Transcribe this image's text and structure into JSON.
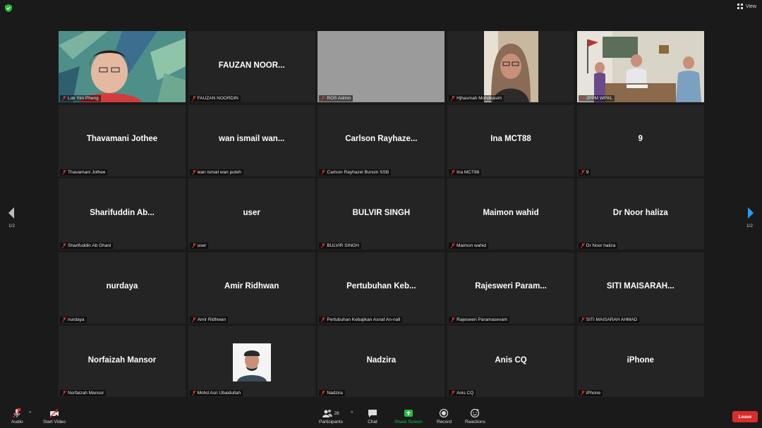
{
  "topbar": {
    "view_label": "View"
  },
  "pagination": {
    "left_page": "1/2",
    "right_page": "1/2"
  },
  "participants": [
    {
      "big": "",
      "label": "Lok Yim Pheng"
    },
    {
      "big": "FAUZAN NOOR...",
      "label": "FAUZAN NOORDIN"
    },
    {
      "big": "",
      "label": "ROS Admin"
    },
    {
      "big": "",
      "label": "Hjhasmah Mohdkasim"
    },
    {
      "big": "",
      "label": "JPPM WPKL"
    },
    {
      "big": "Thavamani Jothee",
      "label": "Thavamani Jothee"
    },
    {
      "big": "wan ismail wan...",
      "label": "wan ismail wan puteh"
    },
    {
      "big": "Carlson Rayhaze...",
      "label": "Carlson Rayhazel Bunsin SSB"
    },
    {
      "big": "Ina MCT88",
      "label": "Ina MCT88"
    },
    {
      "big": "9",
      "label": "9"
    },
    {
      "big": "Sharifuddin Ab...",
      "label": "Sharifuddin Ab Ghani"
    },
    {
      "big": "user",
      "label": "user"
    },
    {
      "big": "BULVIR SINGH",
      "label": "BULVIR SINGH"
    },
    {
      "big": "Maimon wahid",
      "label": "Maimon wahid"
    },
    {
      "big": "Dr Noor haliza",
      "label": "Dr Noor haliza"
    },
    {
      "big": "nurdaya",
      "label": "nurdaya"
    },
    {
      "big": "Amir Ridhwan",
      "label": "Amir Ridhwan"
    },
    {
      "big": "Pertubuhan Keb...",
      "label": "Pertubuhan Kebajikan Asnaf An-nafi"
    },
    {
      "big": "Rajesweri Param...",
      "label": "Rajesweri Paramasevam"
    },
    {
      "big": "SITI MAISARAH...",
      "label": "SITI MAISARAH AHMAD"
    },
    {
      "big": "Norfaizah Mansor",
      "label": "Norfaizah Mansor"
    },
    {
      "big": "",
      "label": "Mohd Asri Ubaidullah"
    },
    {
      "big": "Nadzira",
      "label": "Nadzira"
    },
    {
      "big": "Anis CQ",
      "label": "Anis CQ"
    },
    {
      "big": "iPhone",
      "label": "iPhone"
    }
  ],
  "toolbar": {
    "audio": "Audio",
    "start_video": "Start Video",
    "participants": "Participants",
    "participants_count": "28",
    "chat": "Chat",
    "share_screen": "Share Screen",
    "record": "Record",
    "reactions": "Reactions",
    "leave": "Leave"
  },
  "colors": {
    "accent_green": "#20c040",
    "leave_red": "#d92d2d",
    "active_border": "#d6e24a",
    "arrow_blue": "#2a9df4"
  }
}
